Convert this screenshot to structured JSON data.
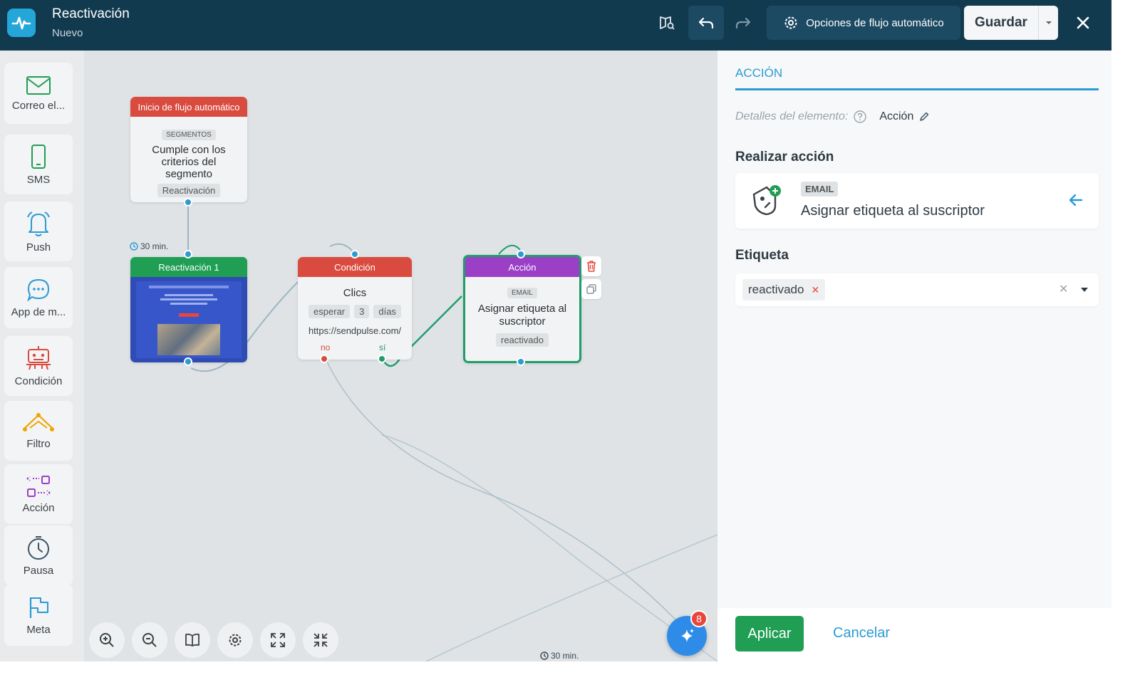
{
  "header": {
    "title": "Reactivación",
    "status": "Nuevo",
    "auto_flow_options_label": "Opciones de flujo automático",
    "save_label": "Guardar"
  },
  "palette": {
    "items": [
      {
        "label": "Correo el...",
        "icon": "envelope-icon"
      },
      {
        "label": "SMS",
        "icon": "phone-icon"
      },
      {
        "label": "Push",
        "icon": "bell-icon"
      },
      {
        "label": "App de m...",
        "icon": "chat-bubble-icon"
      },
      {
        "label": "Condición",
        "icon": "robot-icon"
      },
      {
        "label": "Filtro",
        "icon": "filter-icon"
      },
      {
        "label": "Acción",
        "icon": "action-icon"
      },
      {
        "label": "Pausa",
        "icon": "clock-icon"
      },
      {
        "label": "Meta",
        "icon": "flag-icon"
      }
    ]
  },
  "canvas": {
    "start_node": {
      "header": "Inicio de flujo automático",
      "chip": "SEGMENTOS",
      "text": "Cumple con los criterios del segmento",
      "segment": "Reactivación"
    },
    "wait_label": "30 min.",
    "wait_label_bottom": "30 min.",
    "email_node": {
      "header": "Reactivación 1"
    },
    "condition_node": {
      "header": "Condición",
      "title": "Clics",
      "wait_label": "esperar",
      "wait_value": "3",
      "wait_unit": "días",
      "url": "https://sendpulse.com/",
      "no_label": "no",
      "yes_label": "sí"
    },
    "action_node": {
      "header": "Acción",
      "chip": "EMAIL",
      "text": "Asignar etiqueta al suscriptor",
      "tag": "reactivado"
    },
    "ai_badge_count": "8"
  },
  "panel": {
    "tab": "ACCIÓN",
    "details_label": "Detalles del elemento:",
    "details_value": "Acción",
    "perform_action_title": "Realizar acción",
    "action_card": {
      "chip": "EMAIL",
      "text": "Asignar etiqueta al suscriptor"
    },
    "tag_section_title": "Etiqueta",
    "tag_value": "reactivado",
    "apply_label": "Aplicar",
    "cancel_label": "Cancelar"
  },
  "colors": {
    "topbar": "#123a4f",
    "start_header": "#d94b3f",
    "email_header": "#1f9e54",
    "condition_header": "#d94b3f",
    "action_header": "#9b3fc7",
    "accent": "#2a9bd4"
  }
}
